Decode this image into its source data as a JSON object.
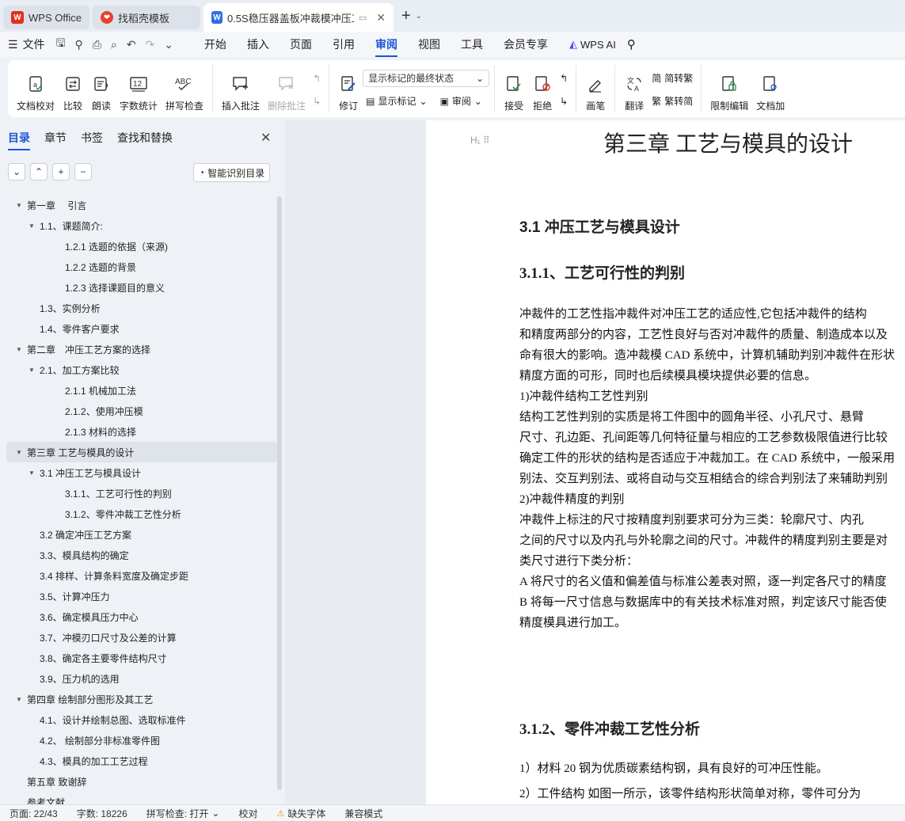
{
  "tabs": [
    {
      "label": "WPS Office",
      "icon": "wps-logo-icon"
    },
    {
      "label": "找稻壳模板",
      "icon": "docer-icon"
    },
    {
      "label": "0.5S稳压器盖板冲裁模冲压工…",
      "icon": "writer-doc-icon"
    }
  ],
  "menubar": {
    "file": "文件",
    "items": [
      "开始",
      "插入",
      "页面",
      "引用",
      "审阅",
      "视图",
      "工具",
      "会员专享"
    ],
    "active": "审阅",
    "ai": "WPS AI"
  },
  "ribbon": {
    "proofread": "文档校对",
    "compare": "比较",
    "read_aloud": "朗读",
    "word_count": "字数统计",
    "spell_check": "拼写检查",
    "insert_comment": "插入批注",
    "delete_comment": "删除批注",
    "track": "修订",
    "display_mode": "显示标记的最终状态",
    "show_markup": "显示标记",
    "review": "审阅",
    "accept": "接受",
    "reject": "拒绝",
    "pen": "画笔",
    "translate": "翻译",
    "to_traditional": "简转繁",
    "to_simplified": "繁转简",
    "restrict_edit": "限制编辑",
    "doc_encrypt": "文档加"
  },
  "nav": {
    "tabs": [
      "目录",
      "章节",
      "书签",
      "查找和替换"
    ],
    "active_tab": "目录",
    "smart_toc": "智能识别目录",
    "toc": [
      {
        "level": 0,
        "caret": true,
        "text": "第一章　 引言"
      },
      {
        "level": 1,
        "caret": true,
        "text": "1.1、课题简介:"
      },
      {
        "level": 2,
        "caret": false,
        "text": "1.2.1 选题的依据（来源)"
      },
      {
        "level": 2,
        "caret": false,
        "text": "1.2.2 选题的背景"
      },
      {
        "level": 2,
        "caret": false,
        "text": "1.2.3 选择课题目的意义"
      },
      {
        "level": 1,
        "caret": false,
        "text": "1.3、实例分析"
      },
      {
        "level": 1,
        "caret": false,
        "text": "1.4、零件客户要求"
      },
      {
        "level": 0,
        "caret": true,
        "text": "第二章　冲压工艺方案的选择"
      },
      {
        "level": 1,
        "caret": true,
        "text": "2.1、加工方案比较"
      },
      {
        "level": 2,
        "caret": false,
        "text": "2.1.1 机械加工法"
      },
      {
        "level": 2,
        "caret": false,
        "text": "2.1.2、使用冲压模"
      },
      {
        "level": 2,
        "caret": false,
        "text": "2.1.3 材料的选择"
      },
      {
        "level": 0,
        "caret": true,
        "text": "第三章  工艺与模具的设计",
        "selected": true
      },
      {
        "level": 1,
        "caret": true,
        "text": "3.1 冲压工艺与模具设计"
      },
      {
        "level": 2,
        "caret": false,
        "text": "3.1.1、工艺可行性的判别"
      },
      {
        "level": 2,
        "caret": false,
        "text": "3.1.2、零件冲裁工艺性分析"
      },
      {
        "level": 1,
        "caret": false,
        "text": "3.2 确定冲压工艺方案"
      },
      {
        "level": 1,
        "caret": false,
        "text": "3.3、模具结构的确定"
      },
      {
        "level": 1,
        "caret": false,
        "text": " 3.4 排样、计算条料宽度及确定步距"
      },
      {
        "level": 1,
        "caret": false,
        "text": "3.5、计算冲压力"
      },
      {
        "level": 1,
        "caret": false,
        "text": "3.6、确定模具压力中心"
      },
      {
        "level": 1,
        "caret": false,
        "text": "3.7、冲模刃口尺寸及公差的计算"
      },
      {
        "level": 1,
        "caret": false,
        "text": "3.8、确定各主要零件结构尺寸"
      },
      {
        "level": 1,
        "caret": false,
        "text": "3.9、压力机的选用"
      },
      {
        "level": 0,
        "caret": true,
        "text": "第四章  绘制部分图形及其工艺"
      },
      {
        "level": 1,
        "caret": false,
        "text": "4.1、设计并绘制总图、选取标准件"
      },
      {
        "level": 1,
        "caret": false,
        "text": "4.2、 绘制部分非标准零件图"
      },
      {
        "level": 1,
        "caret": false,
        "text": "4.3、模具的加工工艺过程"
      },
      {
        "level": 0,
        "caret": false,
        "text": "第五章  致谢辞"
      },
      {
        "level": 0,
        "caret": false,
        "text": "参考文献"
      }
    ]
  },
  "doc": {
    "chapter_title": "第三章  工艺与模具的设计",
    "h2": "3.1 冲压工艺与模具设计",
    "h3a": "3.1.1、工艺可行性的判别",
    "h3b": "3.1.2、零件冲裁工艺性分析",
    "para": [
      "    冲裁件的工艺性指冲裁件对冲压工艺的适应性,它包括冲裁件的结构",
      "和精度两部分的内容，工艺性良好与否对冲裁件的质量、制造成本以及",
      "命有很大的影响。造冲裁模 CAD 系统中，计算机辅助判别冲裁件在形状",
      "精度方面的可形，同时也后续模具模块提供必要的信息。",
      "      1)冲裁件结构工艺性判别",
      "      结构工艺性判别的实质是将工件图中的圆角半径、小孔尺寸、悬臂",
      "尺寸、孔边距、孔间距等几何特征量与相应的工艺参数极限值进行比较",
      "确定工件的形状的结构是否适应于冲裁加工。在 CAD 系统中，一般采用",
      "别法、交互判别法、或将自动与交互相结合的综合判别法了来辅助判别",
      "      2)冲裁件精度的判别",
      "      冲裁件上标注的尺寸按精度判别要求可分为三类：轮廓尺寸、内孔",
      "之间的尺寸以及内孔与外轮廓之间的尺寸。冲裁件的精度判别主要是对",
      "类尺寸进行下类分析：",
      "A 将尺寸的名义值和偏差值与标准公差表对照，逐一判定各尺寸的精度",
      "B 将每一尺寸信息与数据库中的有关技术标准对照，判定该尺寸能否使",
      "精度模具进行加工。"
    ],
    "material_line": "    1）材料          20 钢为优质碳素结构钢，具有良好的可冲压性能。",
    "structure_line": "    2）工件结构    如图一所示，该零件结构形状简单对称，零件可分为"
  },
  "status": {
    "page": "页面: 22/43",
    "words": "字数: 18226",
    "spell": "拼写检查: 打开",
    "proof": "校对",
    "missing_font": "缺失字体",
    "compat": "兼容模式"
  }
}
